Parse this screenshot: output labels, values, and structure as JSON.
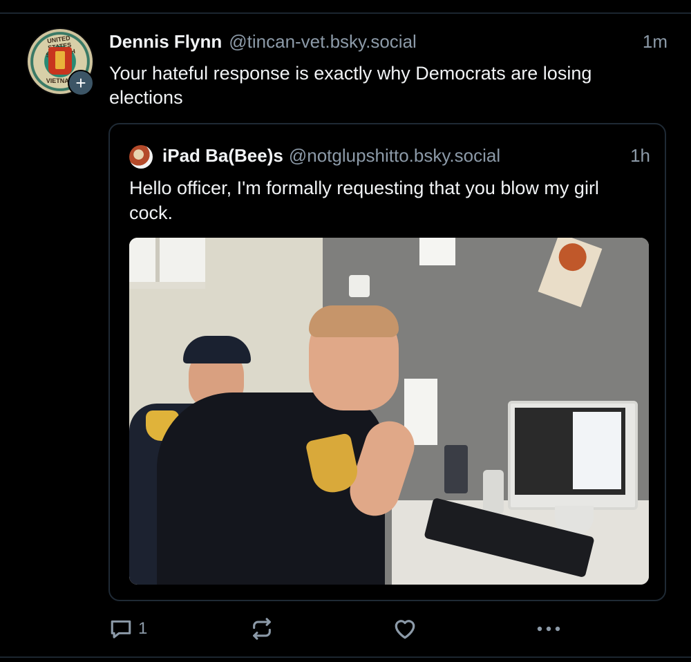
{
  "post": {
    "author": {
      "name": "Dennis Flynn",
      "handle": "@tincan-vet.bsky.social",
      "avatar_top_text": "UNITED STATES SEVENTH FLEET",
      "avatar_bottom_text": "VIETNAM",
      "follow_icon": "plus-icon",
      "follow_glyph": "+"
    },
    "time": "1m",
    "text": "Your hateful response is exactly why Democrats are losing elections",
    "quote": {
      "author": {
        "name": "iPad Ba(Bee)s",
        "handle": "@notglupshitto.bsky.social"
      },
      "time": "1h",
      "text": "Hello officer, I'm formally requesting that you blow my girl cock."
    },
    "actions": {
      "reply_count": "1",
      "reply_icon": "reply-icon",
      "repost_icon": "repost-icon",
      "like_icon": "heart-icon",
      "more_icon": "more-options-icon"
    }
  },
  "colors": {
    "background": "#000000",
    "text_primary": "#f1f3f5",
    "text_secondary": "#8c9aa8",
    "border": "#1f2a35",
    "follow_button": "#3c5566"
  }
}
